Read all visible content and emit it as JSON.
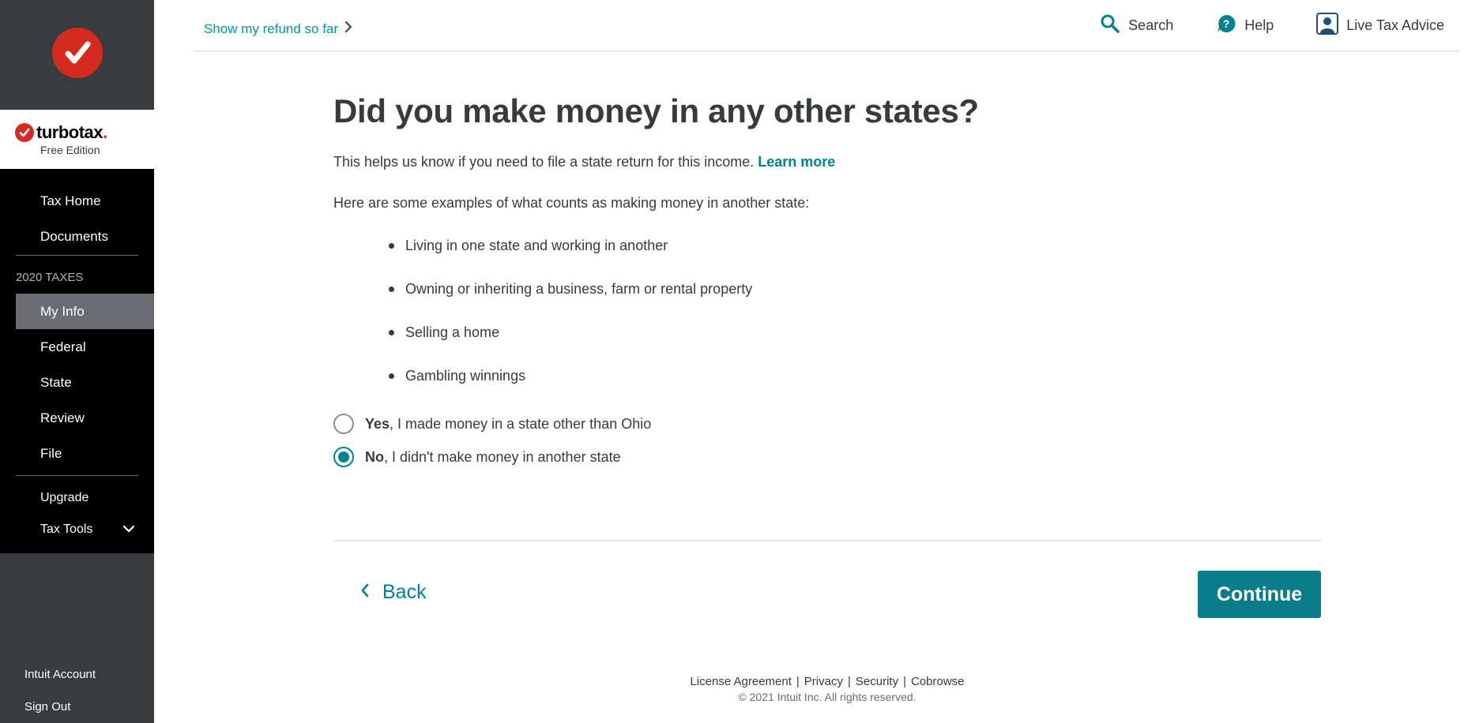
{
  "sidebar": {
    "brand": {
      "name": "turbotax",
      "dot": ".",
      "edition": "Free Edition"
    },
    "items_top": [
      {
        "label": "Tax Home"
      },
      {
        "label": "Documents"
      }
    ],
    "section_label": "2020 TAXES",
    "items_main": [
      {
        "label": "My Info",
        "active": true
      },
      {
        "label": "Federal"
      },
      {
        "label": "State"
      },
      {
        "label": "Review"
      },
      {
        "label": "File"
      }
    ],
    "upgrade_label": "Upgrade",
    "tax_tools_label": "Tax Tools",
    "bottom": [
      {
        "label": "Intuit Account"
      },
      {
        "label": "Sign Out"
      }
    ]
  },
  "header": {
    "refund_link": "Show my refund so far",
    "actions": {
      "search": "Search",
      "help": "Help",
      "live_advice": "Live Tax Advice"
    }
  },
  "main": {
    "title": "Did you make money in any other states?",
    "intro": "This helps us know if you need to file a state return for this income.",
    "learn_more": "Learn more",
    "examples_intro": "Here are some examples of what counts as making money in another state:",
    "examples": [
      "Living in one state and working in another",
      "Owning or inheriting a business, farm or rental property",
      "Selling a home",
      "Gambling winnings"
    ],
    "options": {
      "yes": {
        "strong": "Yes",
        "rest": ", I made money in a state other than Ohio",
        "checked": false
      },
      "no": {
        "strong": "No",
        "rest": ", I didn't make money in another state",
        "checked": true
      }
    },
    "back_label": "Back",
    "continue_label": "Continue"
  },
  "footer": {
    "links": [
      "License Agreement",
      "Privacy",
      "Security",
      "Cobrowse"
    ],
    "copyright": "© 2021 Intuit Inc. All rights reserved."
  },
  "colors": {
    "accent": "#00838f",
    "brand_red": "#d52b1e",
    "sidebar_dark": "#000000",
    "sidebar_gray": "#3a3b3e"
  }
}
